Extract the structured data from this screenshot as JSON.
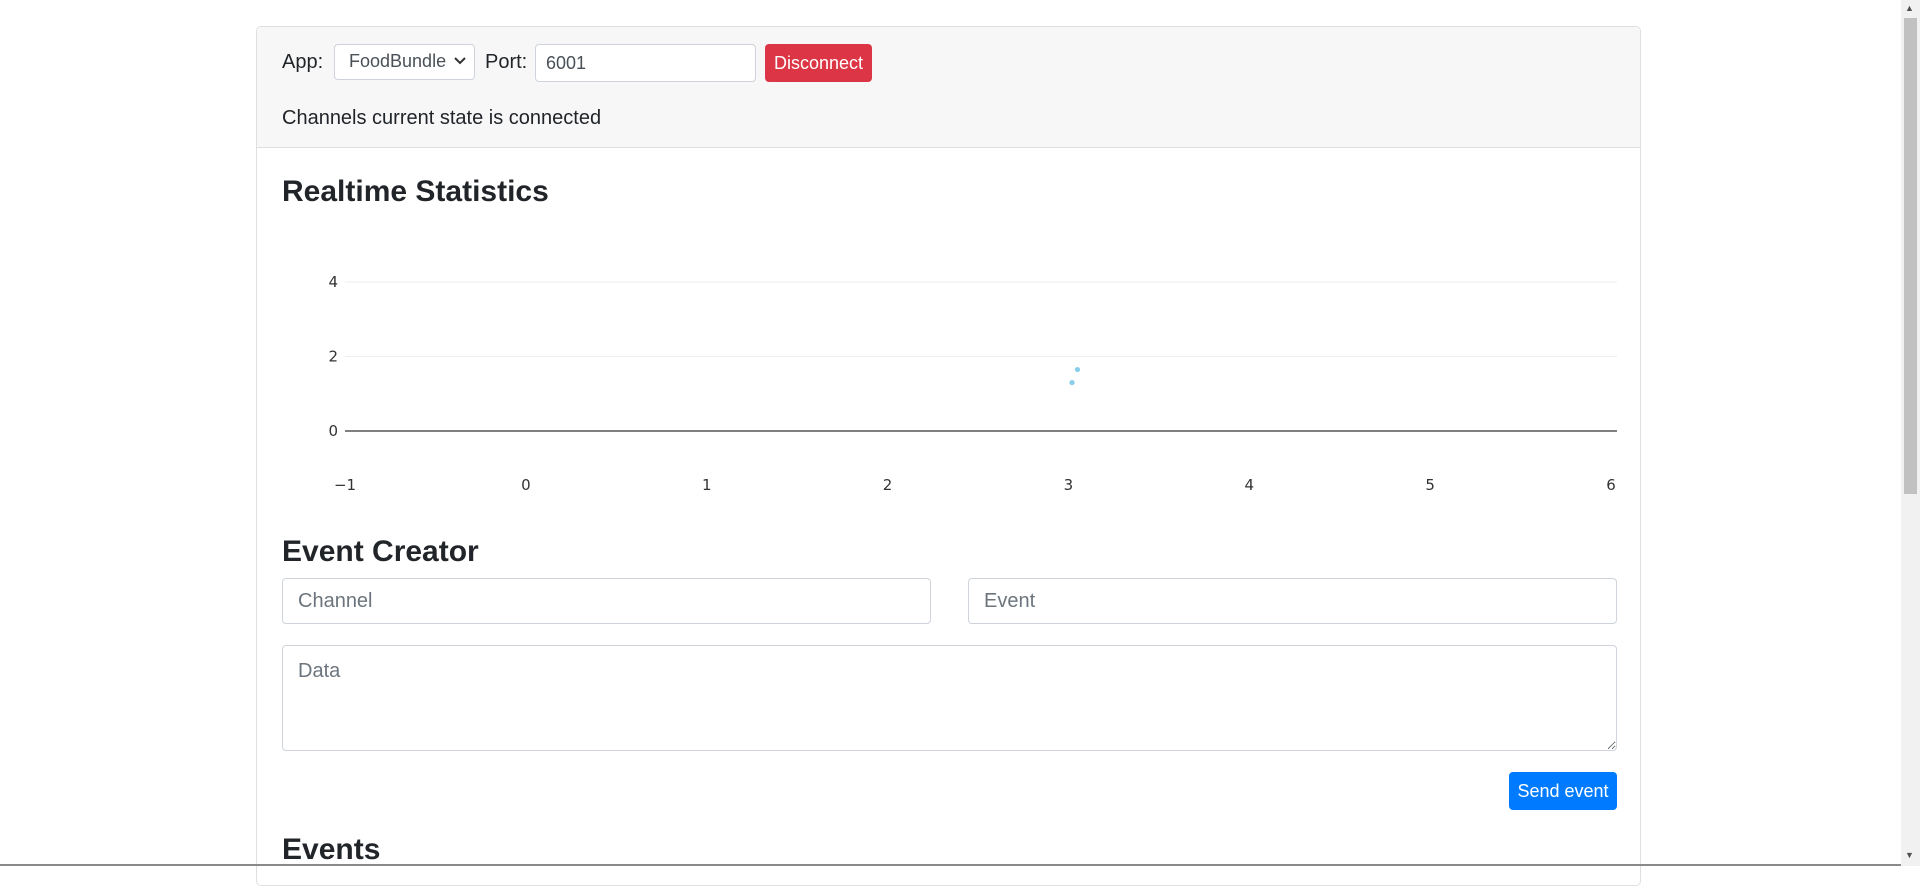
{
  "header": {
    "app_label": "App:",
    "app_selected": "FoodBundle",
    "port_label": "Port:",
    "port_value": "6001",
    "disconnect_label": "Disconnect",
    "state_text": "Channels current state is connected"
  },
  "stats": {
    "title": "Realtime Statistics"
  },
  "chart_data": {
    "type": "scatter",
    "title": "",
    "xlabel": "",
    "ylabel": "",
    "xlim": [
      -1,
      6
    ],
    "ylim": [
      0,
      4
    ],
    "x_ticks": [
      "−1",
      "0",
      "1",
      "2",
      "3",
      "4",
      "5",
      "6"
    ],
    "y_ticks": [
      "0",
      "2",
      "4"
    ],
    "grid": true,
    "color": "#87ceeb",
    "points": [
      {
        "x": 3.05,
        "y": 1.65
      },
      {
        "x": 3.02,
        "y": 1.3
      }
    ]
  },
  "creator": {
    "title": "Event Creator",
    "channel_placeholder": "Channel",
    "event_placeholder": "Event",
    "data_placeholder": "Data",
    "send_label": "Send event"
  },
  "events": {
    "title": "Events"
  }
}
